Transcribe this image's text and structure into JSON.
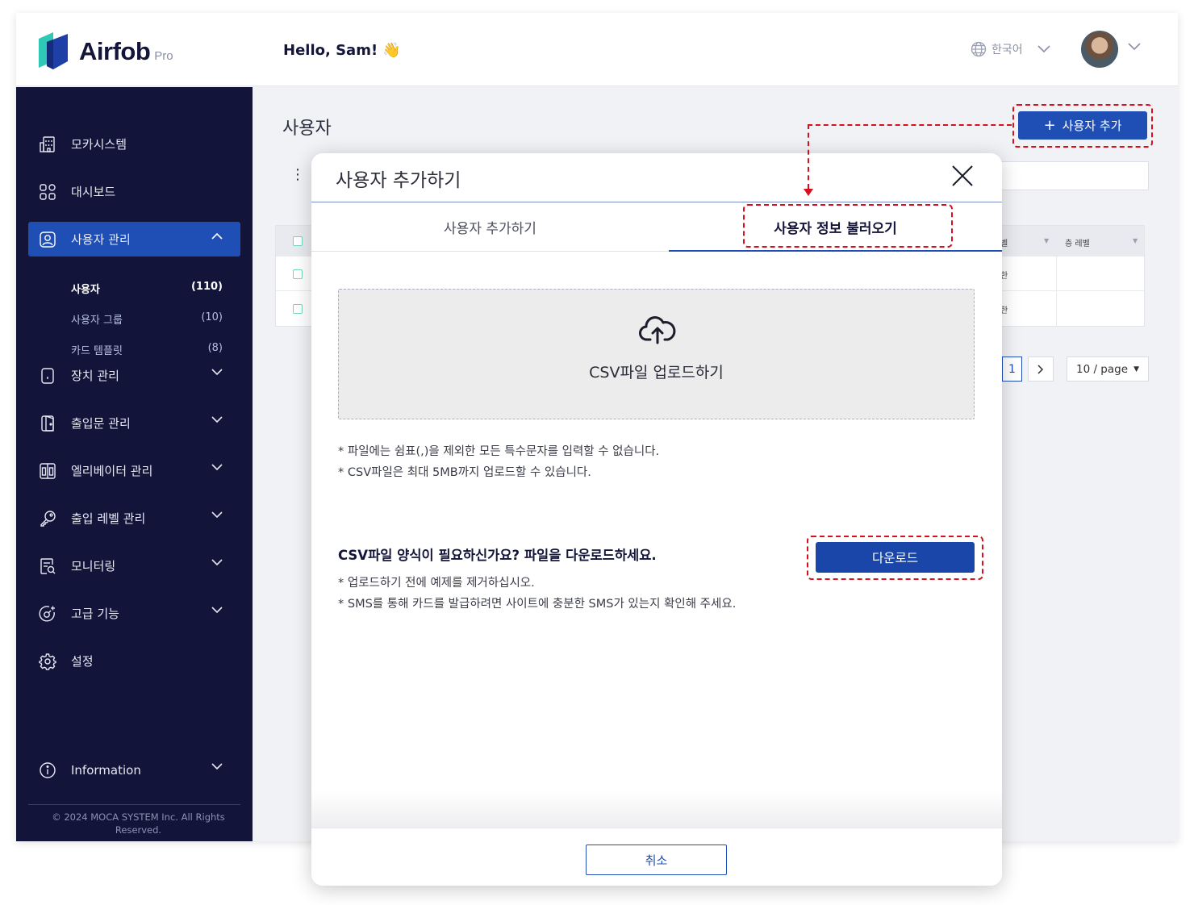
{
  "header": {
    "logo_text": "Airfob",
    "logo_sub": "Pro",
    "greeting": "Hello, Sam! 👋",
    "language": "한국어"
  },
  "sidebar": {
    "items": [
      {
        "label": "모카시스템",
        "icon": "building-icon"
      },
      {
        "label": "대시보드",
        "icon": "dashboard-icon"
      },
      {
        "label": "사용자 관리",
        "icon": "user-icon"
      },
      {
        "label": "장치 관리",
        "icon": "device-icon"
      },
      {
        "label": "출입문 관리",
        "icon": "door-icon"
      },
      {
        "label": "엘리베이터 관리",
        "icon": "elevator-icon"
      },
      {
        "label": "출입 레벨 관리",
        "icon": "key-icon"
      },
      {
        "label": "모니터링",
        "icon": "monitor-icon"
      },
      {
        "label": "고급 기능",
        "icon": "advanced-icon"
      },
      {
        "label": "설정",
        "icon": "gear-icon"
      }
    ],
    "sub_items": [
      {
        "label": "사용자",
        "count": "(110)"
      },
      {
        "label": "사용자 그룹",
        "count": "(10)"
      },
      {
        "label": "카드 템플릿",
        "count": "(8)"
      }
    ],
    "information": "Information",
    "copyright": "© 2024 MOCA SYSTEM Inc. All Rights Reserved."
  },
  "main": {
    "title": "사용자",
    "add_user_label": "사용자 추가",
    "table": {
      "headers": [
        "벨",
        "층 레벨"
      ],
      "cells": [
        "한",
        "한"
      ]
    },
    "pagination": {
      "current_page": "1",
      "page_size": "10 / page"
    }
  },
  "modal": {
    "title": "사용자 추가하기",
    "tabs": [
      "사용자 추가하기",
      "사용자 정보 불러오기"
    ],
    "upload_label": "CSV파일 업로드하기",
    "notes": [
      "* 파일에는 쉼표(,)을 제외한 모든 특수문자를 입력할 수 없습니다.",
      "* CSV파일은 최대 5MB까지 업로드할 수 있습니다."
    ],
    "csv_question": "CSV파일 양식이 필요하신가요? 파일을 다운로드하세요.",
    "download_label": "다운로드",
    "notes2": [
      "* 업로드하기 전에 예제를 제거하십시오.",
      "* SMS를 통해 카드를 발급하려면 사이트에 충분한 SMS가 있는지 확인해 주세요."
    ],
    "cancel_label": "취소"
  },
  "colors": {
    "brand": "#1f4fb5",
    "sidebar_bg": "#12143a",
    "annotation": "#d8101e"
  }
}
